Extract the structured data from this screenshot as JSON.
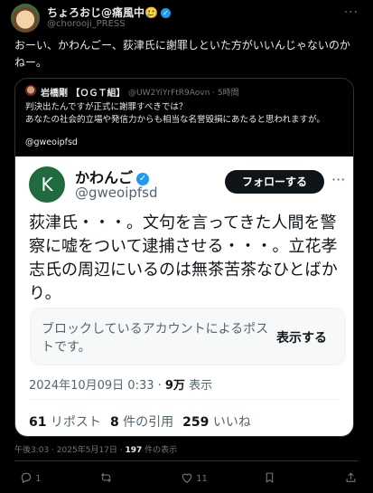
{
  "author": {
    "name": "ちょろおじ@痛風中",
    "emoji": "🥲",
    "handle": "@chorooji_PRESS"
  },
  "tweet_text": "おーい、かわんごー、荻津氏に謝罪しといた方がいいんじゃないのかねー。",
  "quote": {
    "name": "岩橋剛 【ＯＧＴ組】",
    "meta": "@UW2YiYrFtR9Aovn · 5時間",
    "text": "判決出たんですが正式に謝罪すべきでは？\nあなたの社会的立場や発信力からも相当な名誉毀損にあたると思われますが。",
    "mention": "@gweoipfsd",
    "embed": {
      "avatar_letter": "K",
      "name": "かわんご",
      "handle": "@gweoipfsd",
      "follow_label": "フォローする",
      "text": "荻津氏・・・。文句を言ってきた人間を警察に嘘をついて逮捕させる・・・。立花孝志氏の周辺にいるのは無茶苦茶なひとばかり。",
      "blocked_text": "ブロックしているアカウントによるポストです。",
      "blocked_button": "表示する",
      "date": "2024年10月09日 0:33 · ",
      "views": "9万",
      "views_label": " 表示",
      "reposts": "61",
      "reposts_label": " リポスト",
      "quotes": "8",
      "quotes_label": " 件の引用",
      "likes": "259",
      "likes_label": " いいね"
    }
  },
  "timestamp": "午後3:03 · 2025年5月17日 · ",
  "views_count": "197",
  "views_label": " 件の表示",
  "actions": {
    "reply_count": "1",
    "likes_count": "11"
  },
  "colors": {
    "background": "#000000",
    "accent": "#1d9bf0",
    "muted": "#71767b"
  }
}
